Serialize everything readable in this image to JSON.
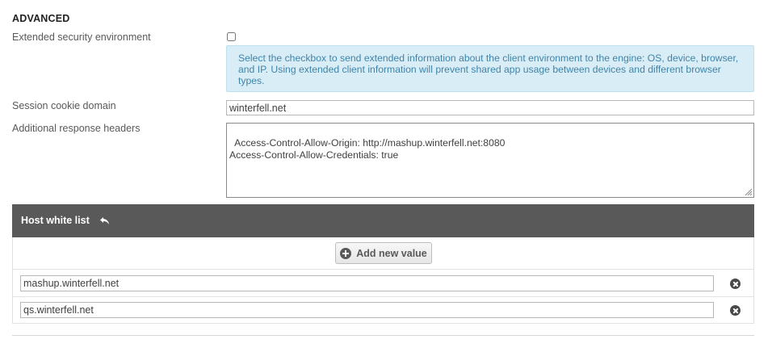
{
  "section": {
    "title": "ADVANCED"
  },
  "extended_security": {
    "label": "Extended security environment",
    "checked": false,
    "info": "Select the checkbox to send extended information about the client environment to the engine: OS, device, browser, and IP. Using extended client information will prevent shared app usage between devices and different browser types."
  },
  "session_cookie": {
    "label": "Session cookie domain",
    "value": "winterfell.net"
  },
  "response_headers": {
    "label": "Additional response headers",
    "value": "Access-Control-Allow-Origin: http://mashup.winterfell.net:8080\nAccess-Control-Allow-Credentials: true"
  },
  "host_white_list": {
    "title": "Host white list",
    "add_label": "Add new value",
    "entries": [
      {
        "value": "mashup.winterfell.net"
      },
      {
        "value": "qs.winterfell.net"
      }
    ]
  },
  "icons": {
    "undo": "undo-icon",
    "add": "plus-circle-icon",
    "remove": "remove-circle-icon"
  }
}
